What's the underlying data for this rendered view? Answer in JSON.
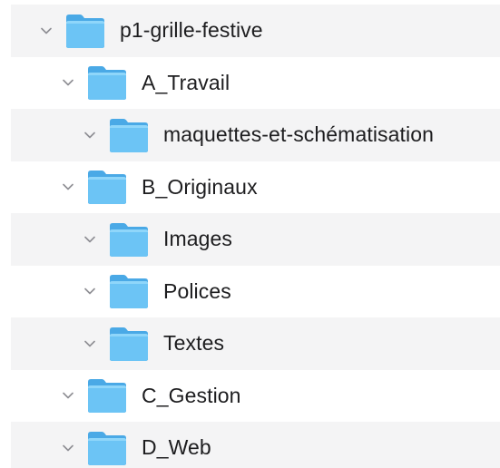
{
  "tree": {
    "items": [
      {
        "label": "p1-grille-festive",
        "icon": "folder-icon",
        "expanded": true
      },
      {
        "label": "A_Travail",
        "icon": "folder-icon",
        "expanded": true
      },
      {
        "label": "maquettes-et-schématisation",
        "icon": "folder-icon",
        "expanded": true
      },
      {
        "label": "B_Originaux",
        "icon": "folder-icon",
        "expanded": true
      },
      {
        "label": "Images",
        "icon": "folder-icon",
        "expanded": true
      },
      {
        "label": "Polices",
        "icon": "folder-icon",
        "expanded": true
      },
      {
        "label": "Textes",
        "icon": "folder-icon",
        "expanded": true
      },
      {
        "label": "C_Gestion",
        "icon": "folder-icon",
        "expanded": true
      },
      {
        "label": "D_Web",
        "icon": "folder-icon",
        "expanded": true
      }
    ]
  },
  "colors": {
    "row_stripe": "#f4f4f5",
    "folder_body": "#5ab8f0",
    "folder_front": "#7ccdf8",
    "chevron": "#8e8e93",
    "text": "#1d1d1f"
  }
}
